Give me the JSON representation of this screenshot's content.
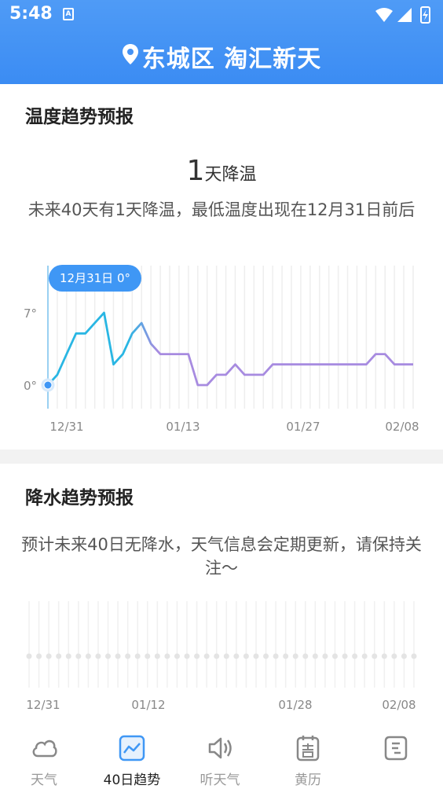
{
  "status": {
    "time": "5:48",
    "badge": "A"
  },
  "header": {
    "location": "东城区 淘汇新天"
  },
  "temperature": {
    "title": "温度趋势预报",
    "count": "1",
    "count_unit": "天降温",
    "description": "未来40天有1天降温，最低温度出现在12月31日前后",
    "tooltip": "12月31日 0°",
    "y_labels": [
      "7°",
      "0°"
    ],
    "x_labels": [
      "12/31",
      "01/13",
      "01/27",
      "02/08"
    ]
  },
  "precip": {
    "title": "降水趋势预报",
    "description": "预计未来40日无降水，天气信息会定期更新，请保持关注～",
    "x_labels": [
      "12/31",
      "01/12",
      "01/28",
      "02/08"
    ]
  },
  "chart_data": [
    {
      "type": "line",
      "x": [
        "12/31",
        "01/01",
        "01/02",
        "01/03",
        "01/04",
        "01/05",
        "01/06",
        "01/07",
        "01/08",
        "01/09",
        "01/10",
        "01/11",
        "01/12",
        "01/13",
        "01/14",
        "01/15",
        "01/16",
        "01/17",
        "01/18",
        "01/19",
        "01/20",
        "01/21",
        "01/22",
        "01/23",
        "01/24",
        "01/25",
        "01/26",
        "01/27",
        "01/28",
        "01/29",
        "01/30",
        "01/31",
        "02/01",
        "02/02",
        "02/03",
        "02/04",
        "02/05",
        "02/06",
        "02/07",
        "02/08"
      ],
      "values": [
        0,
        1,
        3,
        5,
        5,
        6,
        7,
        2,
        3,
        5,
        6,
        4,
        3,
        3,
        3,
        3,
        0,
        0,
        1,
        1,
        2,
        1,
        1,
        1,
        2,
        2,
        2,
        2,
        2,
        2,
        2,
        2,
        2,
        2,
        2,
        3,
        3,
        2,
        2,
        2
      ],
      "ylim": [
        0,
        7
      ],
      "y_tick_labels": [
        "7°",
        "0°"
      ],
      "x_tick_labels": [
        "12/31",
        "01/13",
        "01/27",
        "02/08"
      ],
      "colors": {
        "line_start": "#29b6e3",
        "line_end": "#a78be0",
        "marker": "#3f97f5"
      }
    },
    {
      "type": "scatter",
      "points_count": 40,
      "values": [
        0,
        0,
        0,
        0,
        0,
        0,
        0,
        0,
        0,
        0,
        0,
        0,
        0,
        0,
        0,
        0,
        0,
        0,
        0,
        0,
        0,
        0,
        0,
        0,
        0,
        0,
        0,
        0,
        0,
        0,
        0,
        0,
        0,
        0,
        0,
        0,
        0,
        0,
        0,
        0
      ],
      "x_tick_labels": [
        "12/31",
        "01/12",
        "01/28",
        "02/08"
      ]
    }
  ],
  "tabbar": {
    "items": [
      {
        "label": "天气",
        "icon": "cloud-icon"
      },
      {
        "label": "40日趋势",
        "icon": "trend-chart-icon"
      },
      {
        "label": "听天气",
        "icon": "speaker-icon"
      },
      {
        "label": "黄历",
        "icon": "calendar-icon"
      },
      {
        "label": "",
        "icon": "fortune-icon"
      }
    ],
    "active_color": "#3f97f5",
    "inactive_color": "#999999"
  }
}
